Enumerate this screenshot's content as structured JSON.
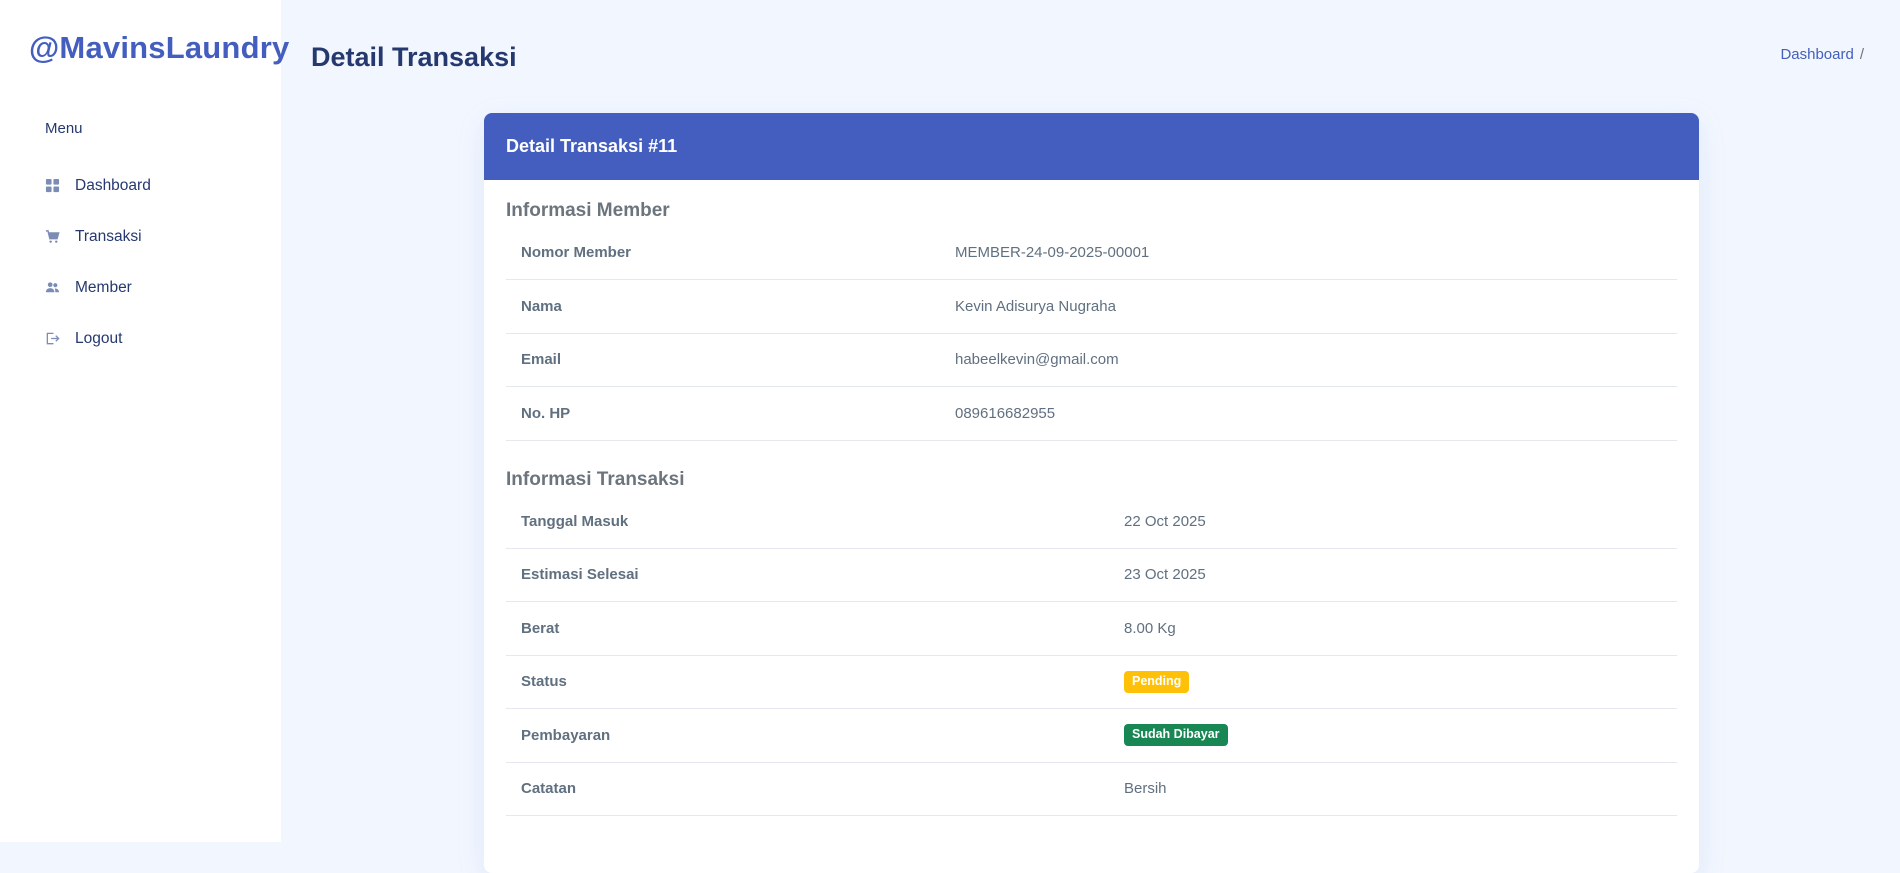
{
  "sidebar": {
    "brand": "@MavinsLaundry",
    "menu_title": "Menu",
    "items": [
      {
        "label": "Dashboard",
        "icon": "grid-icon"
      },
      {
        "label": "Transaksi",
        "icon": "cart-icon"
      },
      {
        "label": "Member",
        "icon": "people-icon"
      },
      {
        "label": "Logout",
        "icon": "logout-icon"
      }
    ]
  },
  "header": {
    "title": "Detail Transaksi",
    "breadcrumb": {
      "home": "Dashboard",
      "separator": "/"
    }
  },
  "card": {
    "title": "Detail Transaksi #11",
    "member_section": {
      "title": "Informasi Member",
      "rows": [
        {
          "label": "Nomor Member",
          "value": "MEMBER-24-09-2025-00001"
        },
        {
          "label": "Nama",
          "value": "Kevin Adisurya Nugraha"
        },
        {
          "label": "Email",
          "value": "habeelkevin@gmail.com"
        },
        {
          "label": "No. HP",
          "value": "089616682955"
        }
      ]
    },
    "transaksi_section": {
      "title": "Informasi Transaksi",
      "rows": [
        {
          "label": "Tanggal Masuk",
          "value": "22 Oct 2025"
        },
        {
          "label": "Estimasi Selesai",
          "value": "23 Oct 2025"
        },
        {
          "label": "Berat",
          "value": "8.00 Kg"
        },
        {
          "label": "Status",
          "value": "Pending"
        },
        {
          "label": "Pembayaran",
          "value": "Sudah Dibayar"
        },
        {
          "label": "Catatan",
          "value": "Bersih"
        }
      ]
    }
  },
  "colors": {
    "accent": "#435ebe",
    "page_bg": "#f2f7ff",
    "status_pending": "#ffc107",
    "status_paid": "#198754"
  }
}
